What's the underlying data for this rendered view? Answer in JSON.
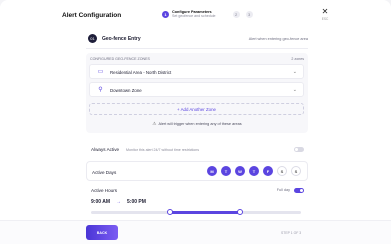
{
  "header": {
    "title": "Alert Configuration",
    "steps": [
      {
        "number": "1",
        "label": "Configure Parameters",
        "sub": "Set geofence and schedule"
      },
      {
        "number": "2"
      },
      {
        "number": "3"
      }
    ],
    "close_icon": "close-icon",
    "close_label": "ESC"
  },
  "geofence": {
    "badge": "01",
    "name": "Geo-fence Entry",
    "hint": "Alert when entering geo-fence area"
  },
  "zones": {
    "heading": "CONFIGURED GEO-FENCE ZONES",
    "count": "2 zones",
    "items": [
      {
        "icon": "building-icon",
        "label": "Residential Area - North District"
      },
      {
        "icon": "pin-icon",
        "label": "Downtown Zone"
      }
    ],
    "add_label": "+ Add Another Zone",
    "note": "Alert will trigger when entering any of these areas"
  },
  "always_active": {
    "label": "Always Active",
    "description": "Monitor this alert 24/7 without time restrictions",
    "enabled": false
  },
  "active_days": {
    "label": "Active Days",
    "days": [
      {
        "label": "M",
        "on": true
      },
      {
        "label": "T",
        "on": true
      },
      {
        "label": "W",
        "on": true
      },
      {
        "label": "T",
        "on": true
      },
      {
        "label": "F",
        "on": true
      },
      {
        "label": "S",
        "on": false
      },
      {
        "label": "S",
        "on": false
      }
    ]
  },
  "active_hours": {
    "label": "Active Hours",
    "start": "9:00 AM",
    "end": "5:00 PM",
    "full_day_label": "Full day",
    "full_day": true,
    "range_start_fraction": 0.375,
    "range_end_fraction": 0.708
  },
  "footer": {
    "back_label": "BACK",
    "step_count": "STEP 1 OF 3"
  },
  "colors": {
    "accent": "#5b45e0",
    "text": "#1b1b2f"
  }
}
